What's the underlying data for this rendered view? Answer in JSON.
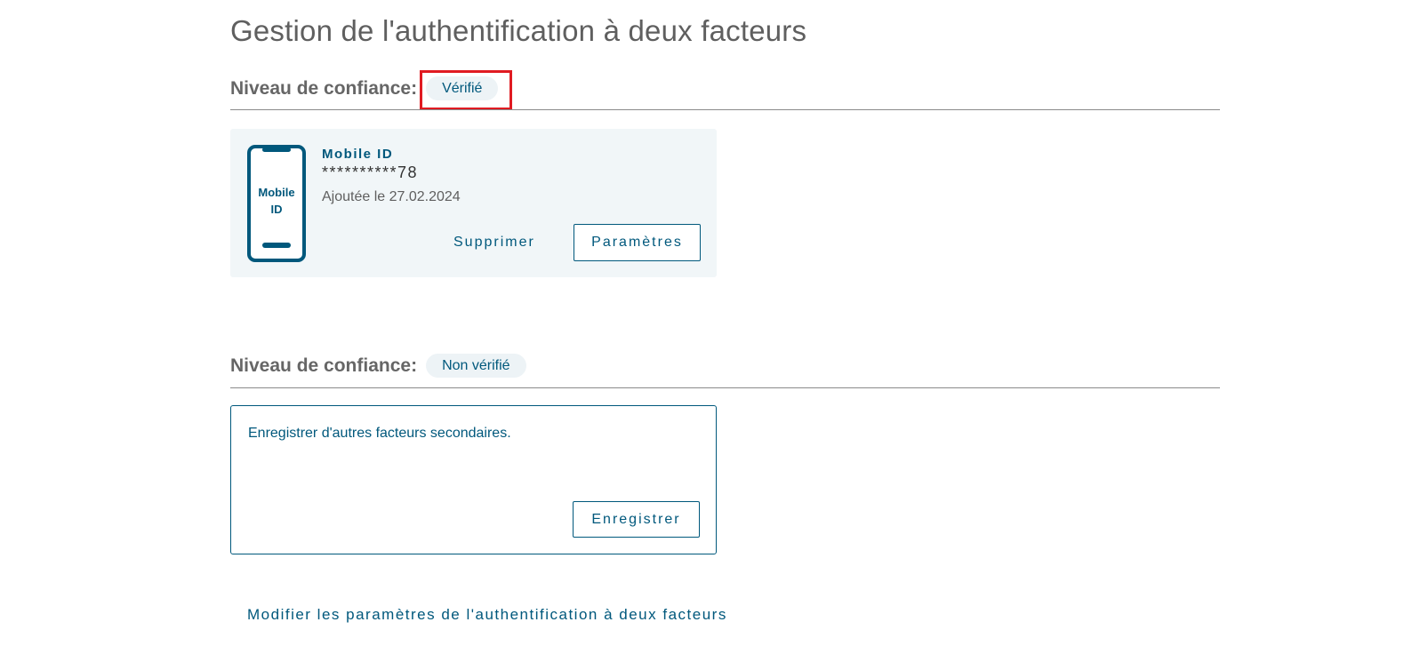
{
  "page": {
    "title": "Gestion de l'authentification à deux facteurs"
  },
  "verified_section": {
    "label": "Niveau de confiance:",
    "badge": "Vérifié",
    "factor": {
      "icon": "mobile-phone-icon",
      "icon_text_line1": "Mobile",
      "icon_text_line2": "ID",
      "name": "Mobile ID",
      "number": "**********78",
      "added_date": "Ajoutée le 27.02.2024",
      "delete_label": "Supprimer",
      "settings_label": "Paramètres"
    }
  },
  "unverified_section": {
    "label": "Niveau de confiance:",
    "badge": "Non vérifié",
    "register_text": "Enregistrer d'autres facteurs secondaires.",
    "register_label": "Enregistrer"
  },
  "footer": {
    "modify_link": "Modifier les paramètres de l'authentification à deux facteurs"
  },
  "colors": {
    "accent": "#00587c",
    "highlight": "#e01b22",
    "card_background": "#f1f6f8",
    "badge_background": "#edf3f6"
  }
}
